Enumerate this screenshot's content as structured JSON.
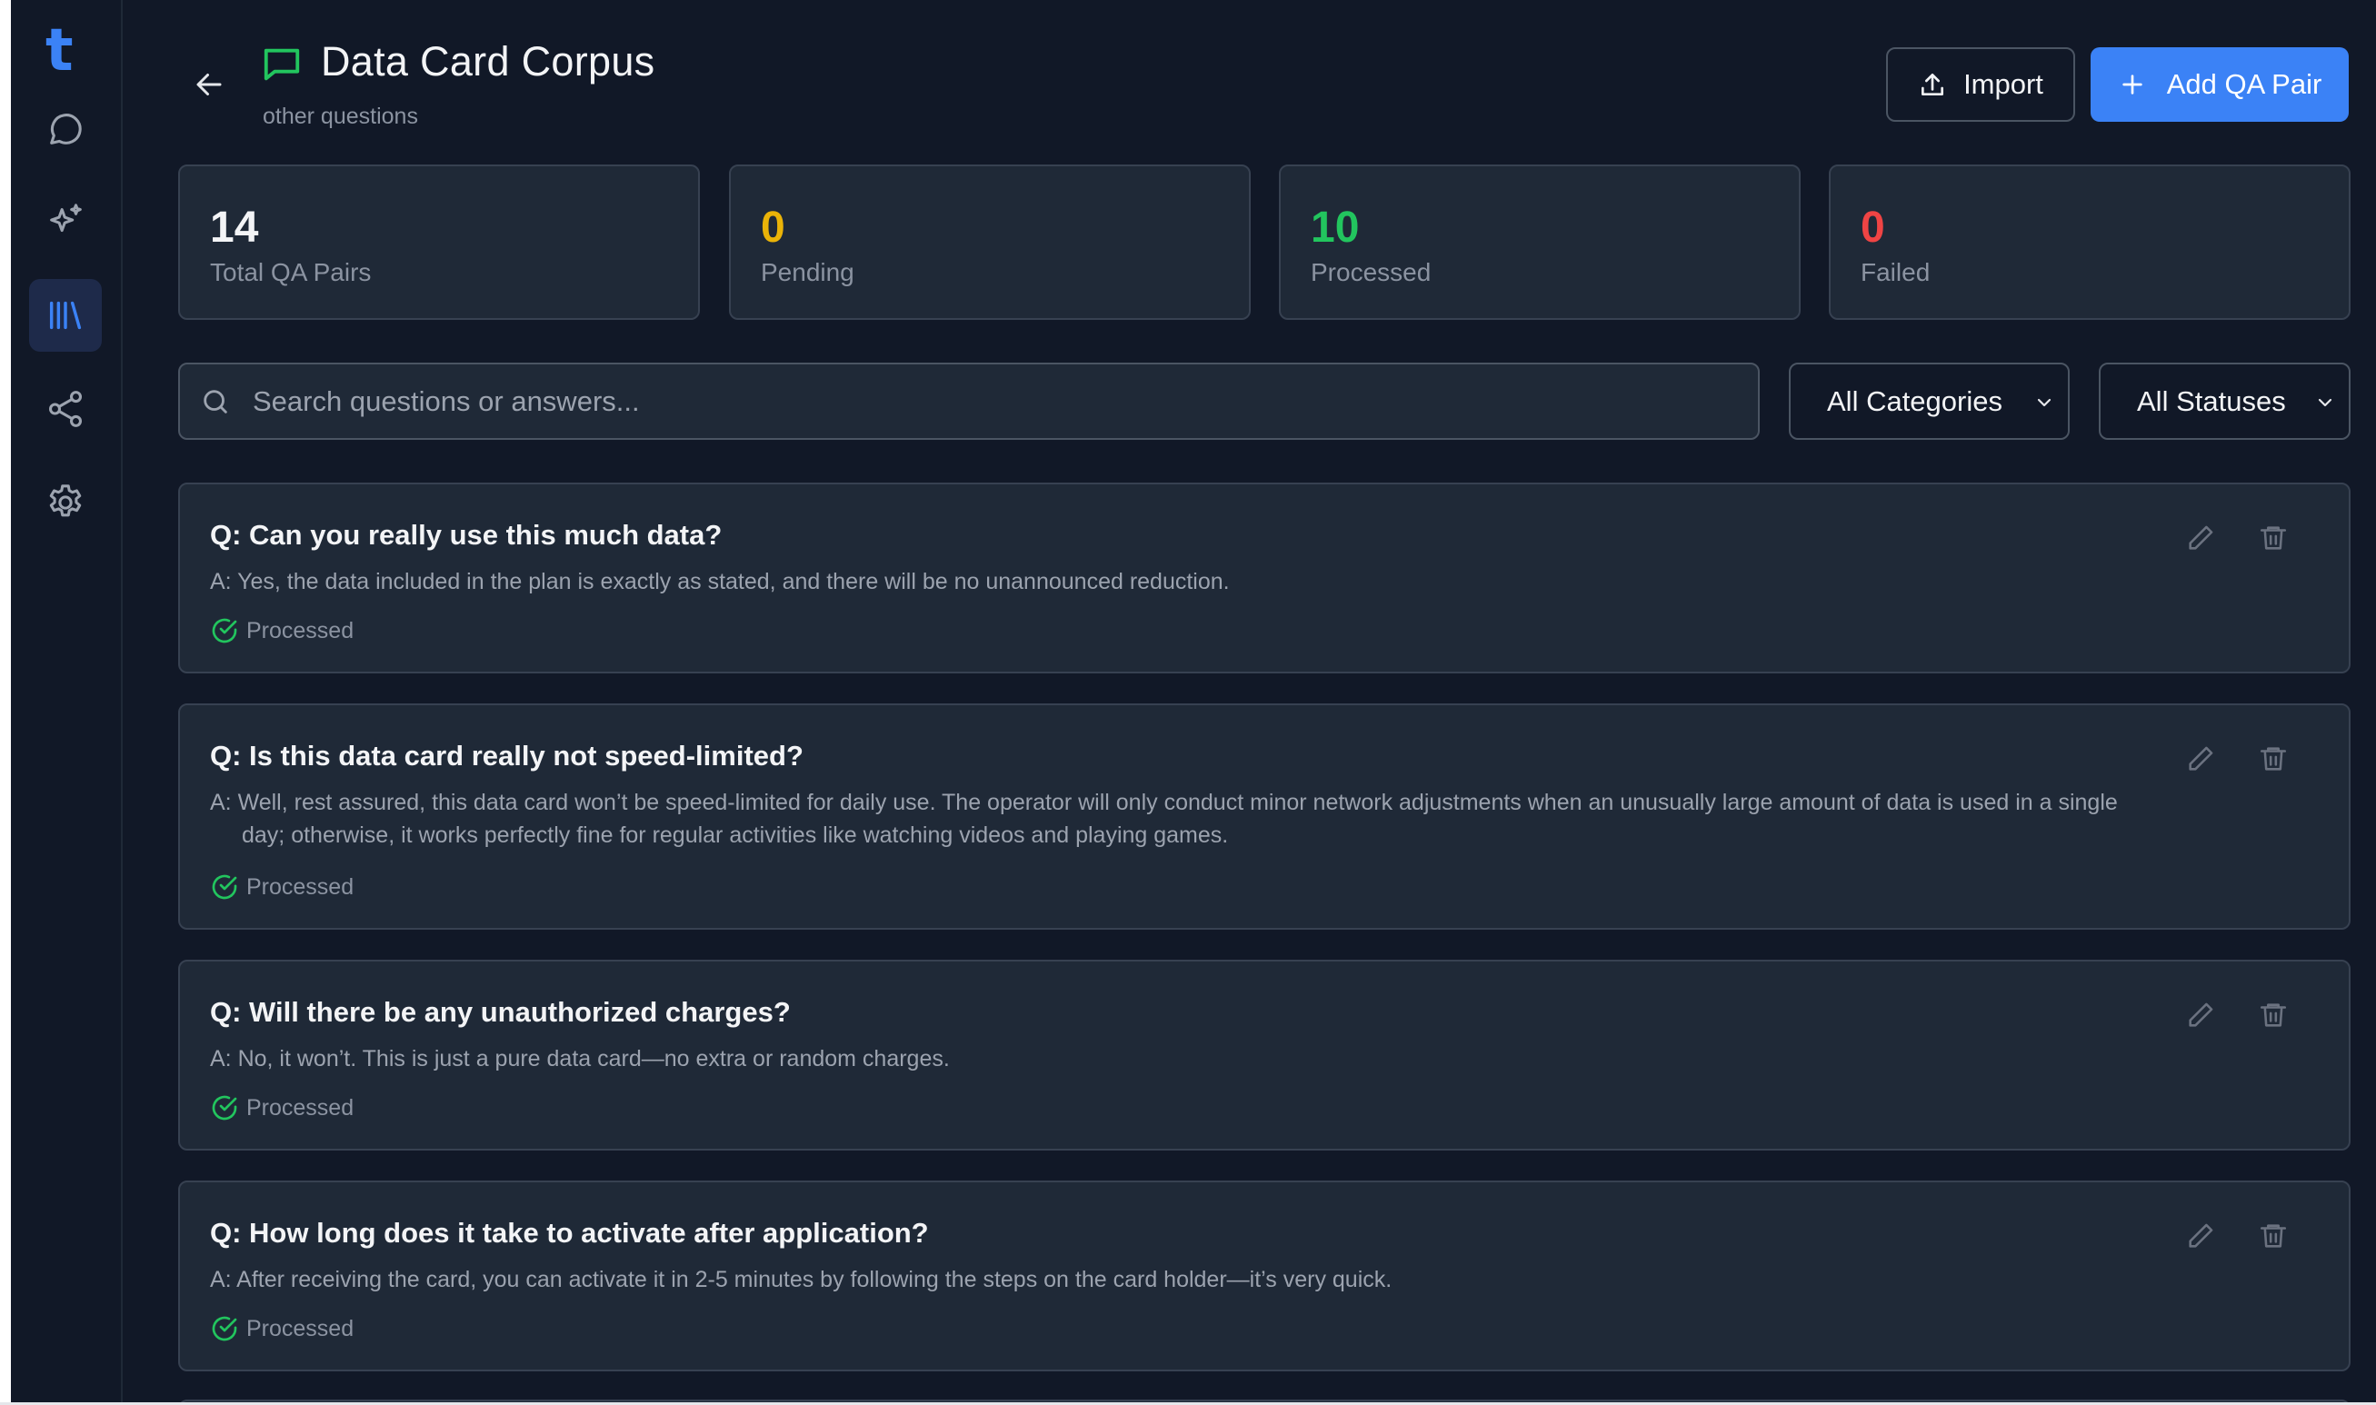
{
  "app": {
    "logo_letter": "t"
  },
  "sidebar": {
    "items": [
      {
        "name": "chat",
        "icon": "chat-bubble-icon",
        "active": false
      },
      {
        "name": "sparkles",
        "icon": "sparkles-icon",
        "active": false
      },
      {
        "name": "library",
        "icon": "library-icon",
        "active": true
      },
      {
        "name": "share",
        "icon": "share-icon",
        "active": false
      },
      {
        "name": "settings",
        "icon": "gear-icon",
        "active": false
      }
    ]
  },
  "header": {
    "title": "Data Card Corpus",
    "subtitle": "other questions",
    "import_label": "Import",
    "add_label": "Add QA Pair"
  },
  "stats": [
    {
      "value": "14",
      "label": "Total QA Pairs",
      "color": "#f3f4f6"
    },
    {
      "value": "0",
      "label": "Pending",
      "color": "#eab308"
    },
    {
      "value": "10",
      "label": "Processed",
      "color": "#22c55e"
    },
    {
      "value": "0",
      "label": "Failed",
      "color": "#ef4444"
    }
  ],
  "filters": {
    "search_placeholder": "Search questions or answers...",
    "category": "All Categories",
    "status": "All Statuses"
  },
  "qa_pairs": [
    {
      "question": "Q: Can you really use this much data?",
      "answer": "A: Yes, the data included in the plan is exactly as stated, and there will be no unannounced reduction.",
      "status": "Processed"
    },
    {
      "question": "Q: Is this data card really not speed-limited?",
      "answer": "A: Well, rest assured, this data card won’t be speed-limited for daily use. The operator will only conduct minor network adjustments when an unusually large amount of data is used in a single day; otherwise, it works perfectly fine for regular activities like watching videos and playing games.",
      "status": "Processed"
    },
    {
      "question": "Q: Will there be any unauthorized charges?",
      "answer": "A: No, it won’t. This is just a pure data card—no extra or random charges.",
      "status": "Processed"
    },
    {
      "question": "Q: How long does it take to activate after application?",
      "answer": "A: After receiving the card, you can activate it in 2-5 minutes by following the steps on the card holder—it’s very quick.",
      "status": "Processed"
    }
  ]
}
